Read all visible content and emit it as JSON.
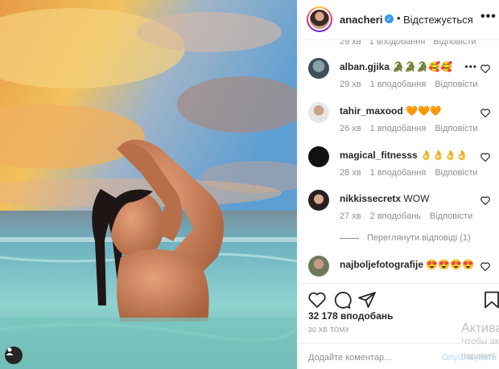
{
  "header": {
    "username": "anacheri",
    "separator": "•",
    "follow_status": "Відстежується",
    "more": "•••"
  },
  "cut_row": {
    "a": "29 хв",
    "b": "1 вподобання",
    "c": "Відповісти"
  },
  "comments": [
    {
      "user": "alban.gjika",
      "text": "🐊🐊🐊🥰🥰",
      "time": "29 хв",
      "likes": "1 вподобання",
      "reply": "Відповісти",
      "more": "•••"
    },
    {
      "user": "tahir_maxood",
      "text": "🧡🧡🧡",
      "time": "26 хв",
      "likes": "1 вподобання",
      "reply": "Відповісти"
    },
    {
      "user": "magical_fitnesss",
      "text": "👌👌👌👌",
      "time": "28 хв",
      "likes": "1 вподобання",
      "reply": "Відповісти"
    },
    {
      "user": "nikkissecretx",
      "text": "WOW",
      "time": "27 хв",
      "likes": "2 вподобань",
      "reply": "Відповісти"
    },
    {
      "user": "najboljefotografije",
      "text": "😍😍😍😍"
    }
  ],
  "view_replies": "Переглянути відповіді (1)",
  "likes": "32 178 вподобань",
  "timestamp": "30 ХВ ТОМУ",
  "add_comment_placeholder": "Додайте коментар...",
  "post_label": "Опублікувати",
  "watermark": {
    "line1": "Актива",
    "line2": "Чтобы ак",
    "line3": "парамет"
  },
  "colors": {
    "link_blue": "#3897f0",
    "meta_gray": "#8e8e8e",
    "post_disabled": "#b3dbff"
  }
}
